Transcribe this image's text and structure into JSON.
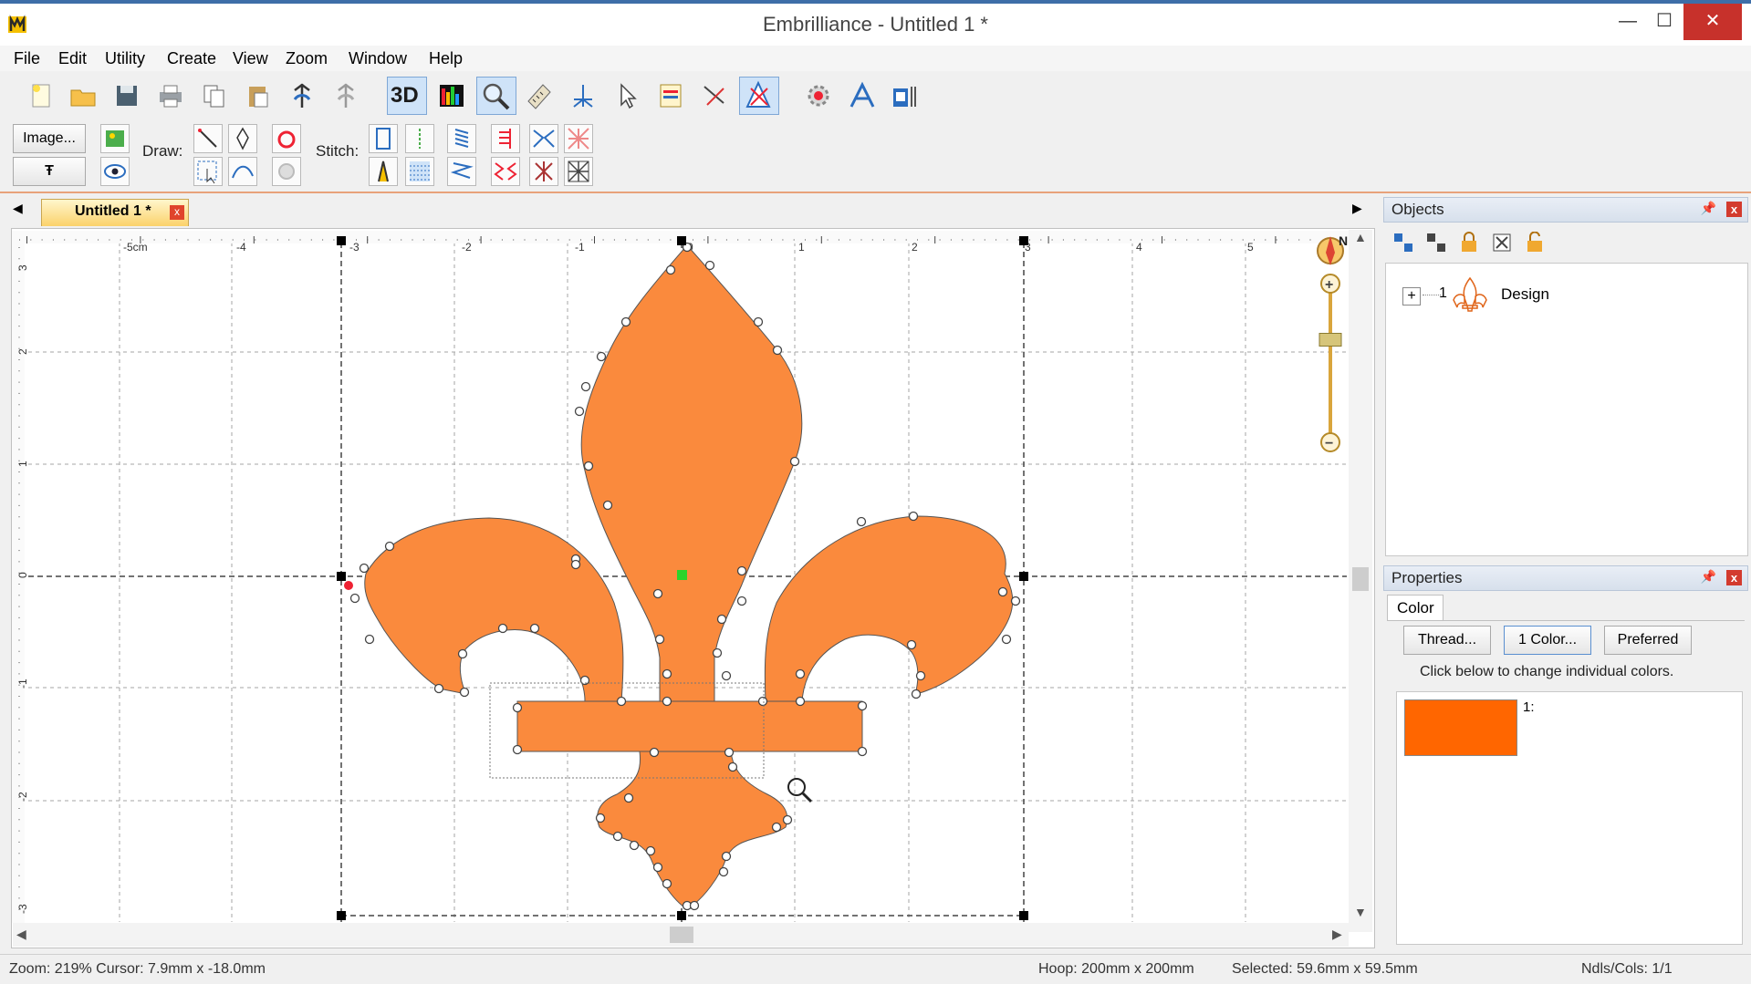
{
  "window": {
    "title": "Embrilliance -  Untitled 1 *",
    "controls": {
      "minimize": "—",
      "maximize": "☐",
      "close": "✕"
    }
  },
  "menu": [
    "File",
    "Edit",
    "Utility",
    "Create",
    "View",
    "Zoom",
    "Window",
    "Help"
  ],
  "toolbar": {
    "threed_label": "3D",
    "image_button": "Image...",
    "draw_label": "Draw:",
    "stitch_label": "Stitch:",
    "text_tool_glyph": "Ŧ"
  },
  "document_tab": {
    "label": "Untitled 1 *",
    "close": "x"
  },
  "ruler": {
    "unit": "cm",
    "x_labels": [
      "-5cm",
      "-4",
      "-3",
      "-2",
      "-1",
      "0",
      "1",
      "2",
      "3",
      "4",
      "5"
    ],
    "y_labels": [
      "-3",
      "-2",
      "-1",
      "0",
      "1",
      "2",
      "3"
    ]
  },
  "zoom_slider": {
    "compass": "N",
    "plus": "+",
    "minus": "−",
    "level": 0.35
  },
  "objects_panel": {
    "title": "Objects",
    "items": [
      {
        "index": "1",
        "label": "Design",
        "expander": "+"
      }
    ]
  },
  "properties_panel": {
    "title": "Properties",
    "tab": "Color",
    "buttons": {
      "thread": "Thread...",
      "colors": "1 Color...",
      "preferred": "Preferred"
    },
    "hint": "Click below to change individual colors.",
    "colors": [
      {
        "index": "1:",
        "hex": "#ff6600"
      }
    ]
  },
  "design": {
    "fill_color": "#fa8a3d",
    "outline_color": "#555555"
  },
  "status": {
    "zoom_cursor": "Zoom: 219%  Cursor: 7.9mm x -18.0mm",
    "hoop": "Hoop: 200mm x 200mm",
    "selected": "Selected: 59.6mm x 59.5mm",
    "ndls": "Ndls/Cols: 1/1"
  }
}
